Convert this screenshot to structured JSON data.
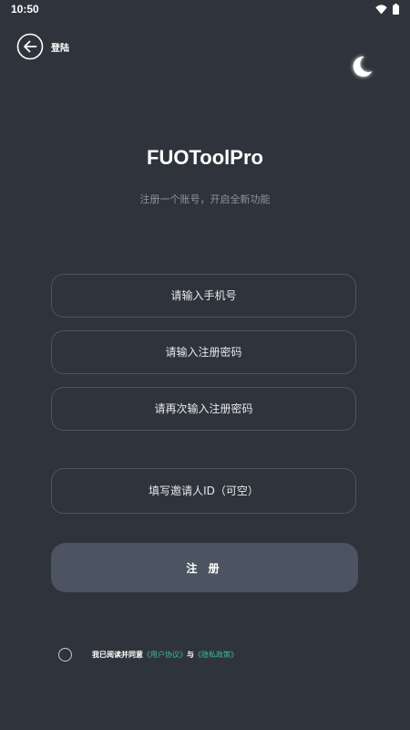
{
  "status_bar": {
    "time": "10:50",
    "icons": [
      "wifi-icon",
      "battery-icon"
    ]
  },
  "header": {
    "back_label": "登陆",
    "back_icon": "back-arrow-icon",
    "theme_icon": "moon-icon"
  },
  "main": {
    "title": "FUOToolPro",
    "subtitle": "注册一个账号，开启全新功能",
    "phone_placeholder": "请输入手机号",
    "password_placeholder": "请输入注册密码",
    "password_confirm_placeholder": "请再次输入注册密码",
    "inviter_placeholder": "填写邀请人ID（可空）",
    "register_label": "注 册"
  },
  "agreement": {
    "prefix": "我已阅读并同意",
    "user_agreement": "《用户协议》",
    "conjunction": "与",
    "privacy_policy": "《隐私政策》",
    "checked": false
  },
  "colors": {
    "background": "#2f343c",
    "field_border": "#4e545d",
    "button_bg": "#4b5460",
    "link": "#3fb8a3",
    "subtitle": "#8e949c"
  }
}
